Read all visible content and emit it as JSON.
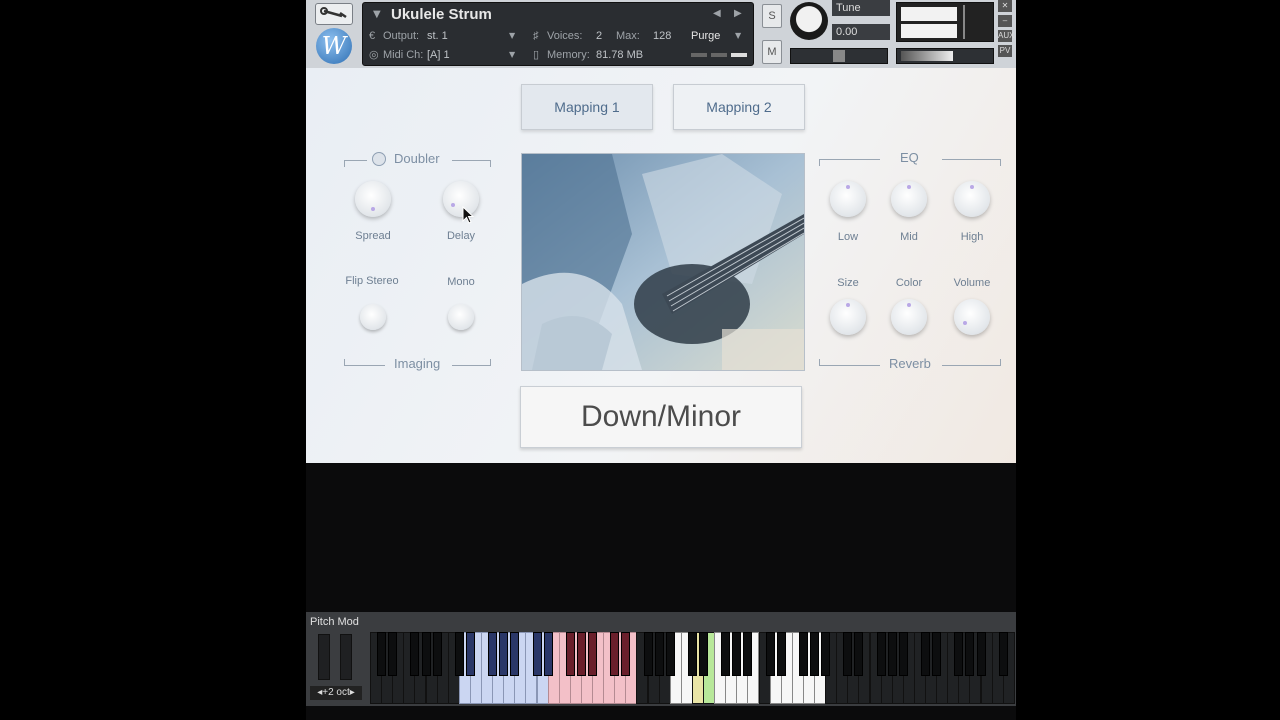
{
  "header": {
    "instrument_name": "Ukulele Strum",
    "output_label": "Output:",
    "output_value": "st. 1",
    "voices_label": "Voices:",
    "voices_value": "2",
    "max_label": "Max:",
    "max_value": "128",
    "purge_label": "Purge",
    "midi_label": "Midi Ch:",
    "midi_value": "[A] 1",
    "memory_label": "Memory:",
    "memory_value": "81.78 MB",
    "solo_label": "S",
    "mute_label": "M",
    "tune_label": "Tune",
    "tune_value": "0.00",
    "aux_label": "AUX",
    "pv_label": "PV",
    "logo_letter": "W"
  },
  "tabs": [
    {
      "label": "Mapping 1",
      "active": true
    },
    {
      "label": "Mapping 2",
      "active": false
    }
  ],
  "doubler": {
    "title": "Doubler",
    "knobs": [
      {
        "label": "Spread"
      },
      {
        "label": "Delay"
      }
    ]
  },
  "imaging": {
    "title": "Imaging",
    "controls": [
      {
        "label": "Flip Stereo"
      },
      {
        "label": "Mono"
      }
    ]
  },
  "eq": {
    "title": "EQ",
    "knobs": [
      {
        "label": "Low"
      },
      {
        "label": "Mid"
      },
      {
        "label": "High"
      }
    ]
  },
  "reverb": {
    "title": "Reverb",
    "knobs": [
      {
        "label": "Size"
      },
      {
        "label": "Color"
      },
      {
        "label": "Volume"
      }
    ]
  },
  "mode_label": "Down/Minor",
  "keyboard": {
    "pitch_mod_label": "Pitch Mod",
    "octave_label": "+2 oct",
    "colors": {
      "blue": "#cbd6f2",
      "red": "#f3c0c8",
      "white": "#f7f7f7",
      "inactive": "#202224"
    }
  }
}
